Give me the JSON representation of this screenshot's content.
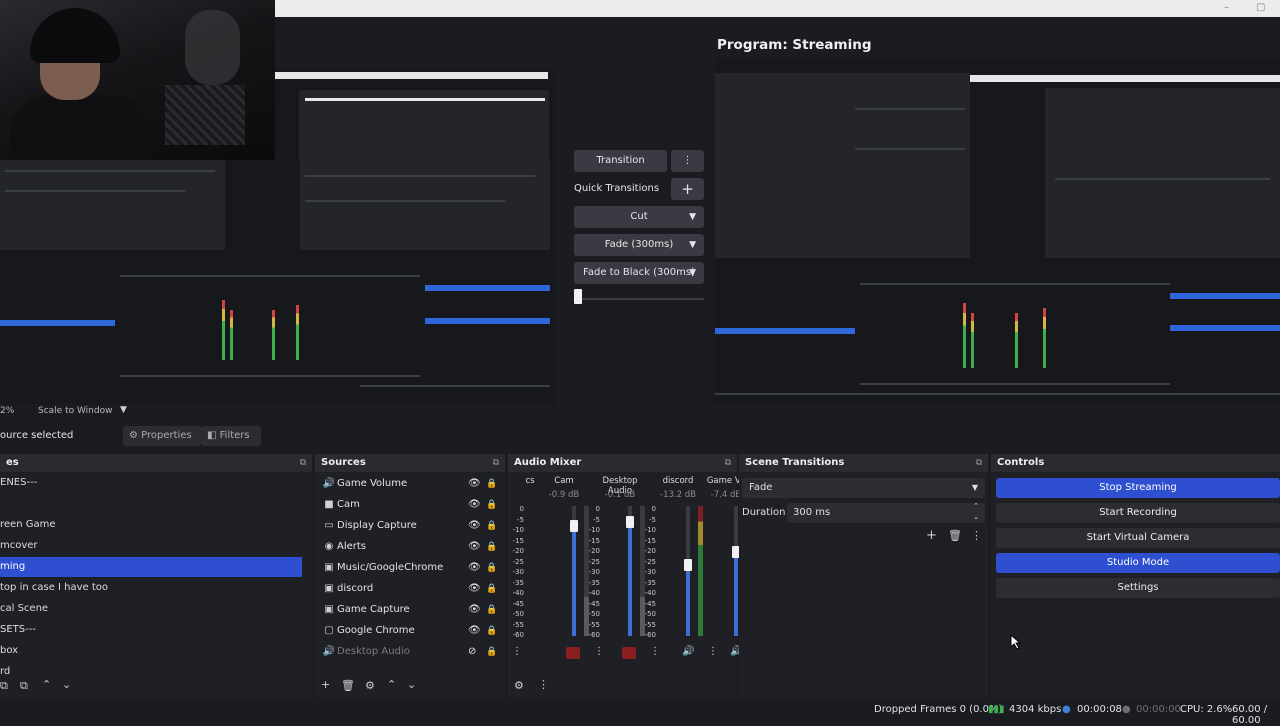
{
  "window": {
    "minimize_glyph": "–",
    "maximize_glyph": "▢"
  },
  "program": {
    "title": "Program: Streaming"
  },
  "transition_panel": {
    "transition_label": "Transition",
    "menu_glyph": "⋮",
    "quick_transitions_label": "Quick Transitions",
    "add_glyph": "+",
    "quick_items": [
      {
        "label": "Cut"
      },
      {
        "label": "Fade (300ms)"
      },
      {
        "label": "Fade to Black (300ms)"
      }
    ]
  },
  "preview_toolbar": {
    "zoom": "2%",
    "scale_label": "Scale to Window"
  },
  "properties_bar": {
    "source_selected": "ource selected",
    "properties_label": "Properties",
    "filters_label": "Filters"
  },
  "scenes": {
    "title": "es",
    "items": [
      {
        "label": "ENES---",
        "selected": false
      },
      {
        "label": "",
        "selected": false
      },
      {
        "label": "reen Game",
        "selected": false
      },
      {
        "label": "mcover",
        "selected": false
      },
      {
        "label": "ming",
        "selected": true
      },
      {
        "label": "top in case I have too",
        "selected": false
      },
      {
        "label": "cal Scene",
        "selected": false
      },
      {
        "label": "SETS---",
        "selected": false
      },
      {
        "label": "box",
        "selected": false
      },
      {
        "label": "rd",
        "selected": false
      }
    ]
  },
  "sources": {
    "title": "Sources",
    "items": [
      {
        "label": "Game Volume",
        "icon": "speaker-icon",
        "glyph": "🔊",
        "visible": true
      },
      {
        "label": "Cam",
        "icon": "camera-icon",
        "glyph": "■",
        "visible": true
      },
      {
        "label": "Display Capture",
        "icon": "display-icon",
        "glyph": "▭",
        "visible": true
      },
      {
        "label": "Alerts",
        "icon": "globe-icon",
        "glyph": "◉",
        "visible": true
      },
      {
        "label": "Music/GoogleChrome",
        "icon": "window-icon",
        "glyph": "▣",
        "visible": true
      },
      {
        "label": "discord",
        "icon": "window-icon",
        "glyph": "▣",
        "visible": true
      },
      {
        "label": "Game Capture",
        "icon": "gamepad-icon",
        "glyph": "▣",
        "visible": true
      },
      {
        "label": "Google Chrome",
        "icon": "window-icon",
        "glyph": "▢",
        "visible": true
      },
      {
        "label": "Desktop Audio",
        "icon": "speaker-icon",
        "glyph": "🔊",
        "visible": false
      }
    ]
  },
  "audio_mixer": {
    "title": "Audio Mixer",
    "channels": [
      {
        "name": "cs",
        "db": ""
      },
      {
        "name": "Cam",
        "db": "-0.9 dB",
        "level": 0.85
      },
      {
        "name": "Desktop Audio",
        "db": "-0.1 dB",
        "level": 0.88
      },
      {
        "name": "discord",
        "db": "-13.2 dB",
        "level": 0.55
      },
      {
        "name": "Game Vo",
        "db": "-7.4 dB",
        "level": 0.65
      }
    ],
    "ticks": [
      "0",
      "-5",
      "-10",
      "-15",
      "-20",
      "-25",
      "-30",
      "-35",
      "-40",
      "-45",
      "-50",
      "-55",
      "-60"
    ]
  },
  "scene_transitions": {
    "title": "Scene Transitions",
    "selected": "Fade",
    "duration_label": "Duration",
    "duration_value": "300 ms"
  },
  "controls": {
    "title": "Controls",
    "buttons": [
      {
        "label": "Stop Streaming",
        "active": true
      },
      {
        "label": "Start Recording",
        "active": false
      },
      {
        "label": "Start Virtual Camera",
        "active": false
      },
      {
        "label": "Studio Mode",
        "active": true
      },
      {
        "label": "Settings",
        "active": false
      }
    ]
  },
  "status_bar": {
    "dropped_frames": "Dropped Frames 0 (0.0%)",
    "bitrate": "4304 kbps",
    "stream_time": "00:00:08",
    "record_time": "00:00:00",
    "cpu": "CPU: 2.6%",
    "fps": "60.00 / 60.00"
  },
  "colors": {
    "accent": "#2d4fd0",
    "panel": "#1f2026",
    "background": "#1b1c21"
  }
}
